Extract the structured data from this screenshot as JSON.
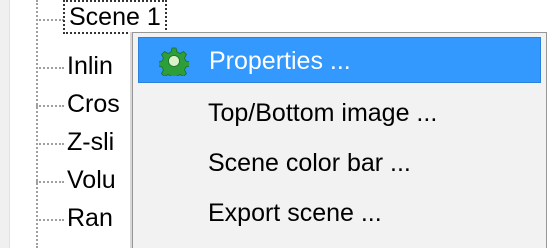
{
  "tree": {
    "items": [
      {
        "label": "Scene 1",
        "selected": true
      },
      {
        "label": "Inlin"
      },
      {
        "label": "Cros"
      },
      {
        "label": "Z-sli"
      },
      {
        "label": "Volu"
      },
      {
        "label": "Ran"
      }
    ]
  },
  "context_menu": {
    "items": [
      {
        "label": "Properties ...",
        "icon": "gear-icon",
        "highlighted": true
      },
      {
        "label": "Top/Bottom image ..."
      },
      {
        "label": "Scene color bar ..."
      },
      {
        "label": "Export scene ..."
      }
    ]
  },
  "colors": {
    "highlight": "#3399ff",
    "menu_background": "#f2f2f2",
    "gear_icon": "#2e9e3a"
  }
}
